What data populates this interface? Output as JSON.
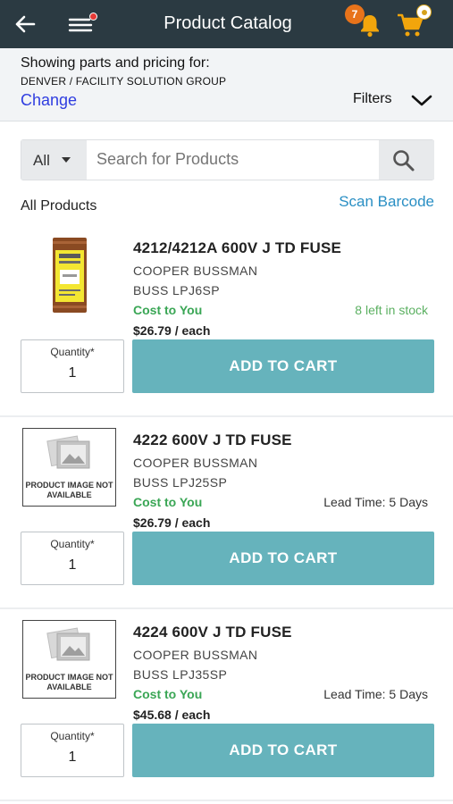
{
  "header": {
    "title": "Product Catalog",
    "notification_count": "7",
    "back_icon": "arrow-left-icon",
    "menu_icon": "hamburger-menu-icon",
    "bell_icon": "bell-icon",
    "cart_icon": "shopping-cart-icon",
    "bar_color": "#2b3a42",
    "accent_color": "#f2a50c"
  },
  "location": {
    "heading": "Showing parts and pricing for:",
    "name": "DENVER / FACILITY SOLUTION GROUP",
    "change_label": "Change",
    "filters_label": "Filters"
  },
  "search": {
    "scope": "All",
    "placeholder": "Search for Products",
    "value": ""
  },
  "listing": {
    "heading": "All Products",
    "scan_label": "Scan Barcode"
  },
  "products": [
    {
      "name": "4212/4212A 600V J TD FUSE",
      "brand": "COOPER BUSSMAN",
      "part": "BUSS LPJ6SP",
      "cost_label": "Cost to You",
      "availability": "8 left in stock",
      "price": "$26.79 / each",
      "qty_label": "Quantity*",
      "qty": "1",
      "add_label": "ADD TO CART",
      "image": "fuse-photo"
    },
    {
      "name": "4222 600V J TD FUSE",
      "brand": "COOPER BUSSMAN",
      "part": "BUSS LPJ25SP",
      "cost_label": "Cost to You",
      "availability": "Lead Time: 5 Days",
      "price": "$26.79 / each",
      "qty_label": "Quantity*",
      "qty": "1",
      "add_label": "ADD TO CART",
      "image": "product-image-not-available",
      "placeholder_text": "PRODUCT IMAGE NOT AVAILABLE"
    },
    {
      "name": "4224 600V J TD FUSE",
      "brand": "COOPER BUSSMAN",
      "part": "BUSS LPJ35SP",
      "cost_label": "Cost to You",
      "availability": "Lead Time: 5 Days",
      "price": "$45.68 / each",
      "qty_label": "Quantity*",
      "qty": "1",
      "add_label": "ADD TO CART",
      "image": "product-image-not-available",
      "placeholder_text": "PRODUCT IMAGE NOT AVAILABLE"
    }
  ]
}
